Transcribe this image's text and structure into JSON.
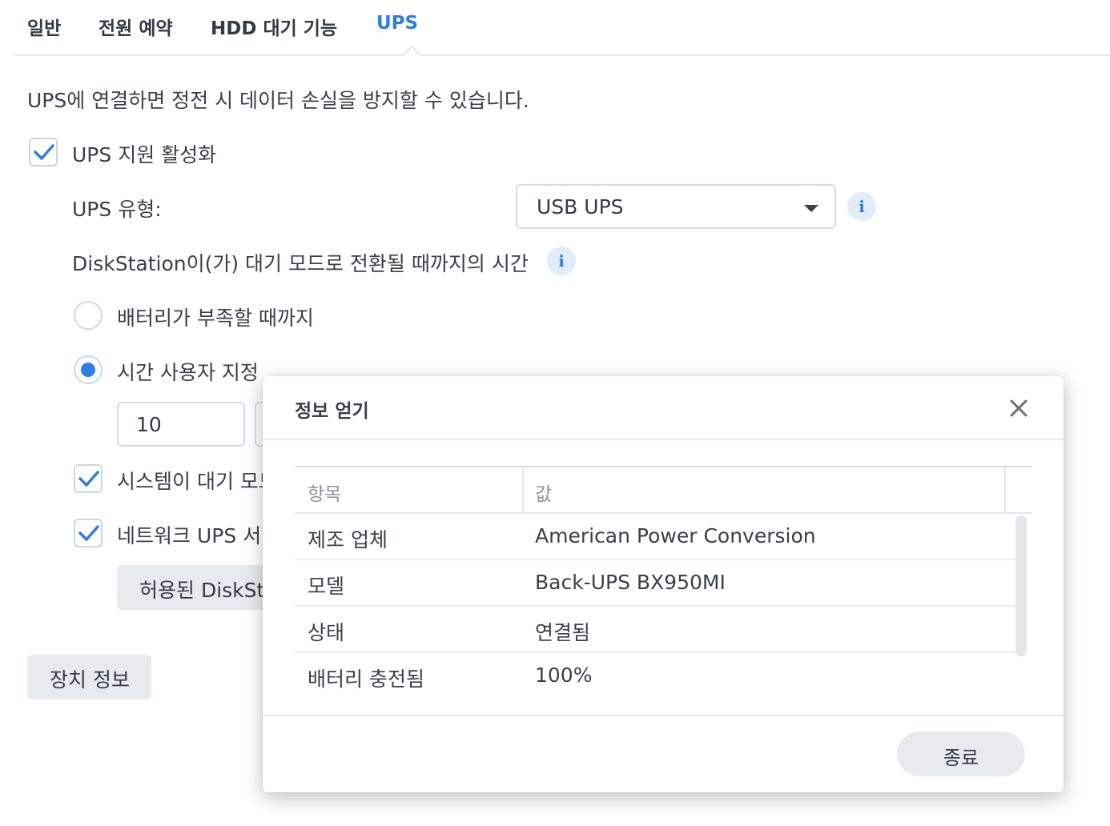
{
  "tabs": [
    {
      "label": "일반"
    },
    {
      "label": "전원 예약"
    },
    {
      "label": "HDD 대기 기능"
    },
    {
      "label": "UPS"
    }
  ],
  "active_tab": "UPS",
  "accent_color": "#2f7de1",
  "description": "UPS에 연결하면 정전 시 데이터 손실을 방지할 수 있습니다.",
  "ups_support": {
    "label": "UPS 지원 활성화",
    "checked": true
  },
  "ups_type": {
    "label": "UPS 유형:",
    "value": "USB UPS"
  },
  "standby": {
    "label": "DiskStation이(가) 대기 모드로 전환될 때까지의 시간",
    "option_battery_low": {
      "label": "배터리가 부족할 때까지",
      "checked": false
    },
    "option_custom": {
      "label": "시간 사용자 지정",
      "checked": true
    },
    "custom_value": "10"
  },
  "shutdown_ups": {
    "label": "시스템이 대기 모드",
    "checked": true
  },
  "network_ups": {
    "label": "네트워크 UPS 서",
    "checked": true
  },
  "allowed_button": {
    "label": "허용된 DiskSt"
  },
  "device_info_button": {
    "label": "장치 정보"
  },
  "modal": {
    "title": "정보 얻기",
    "columns": {
      "item": "항목",
      "value": "값"
    },
    "rows": [
      {
        "item": "제조 업체",
        "value": "American Power Conversion"
      },
      {
        "item": "모델",
        "value": "Back-UPS BX950MI"
      },
      {
        "item": "상태",
        "value": "연결됨"
      },
      {
        "item": "배터리 충전됨",
        "value": "100%"
      }
    ],
    "close_button": "종료"
  }
}
